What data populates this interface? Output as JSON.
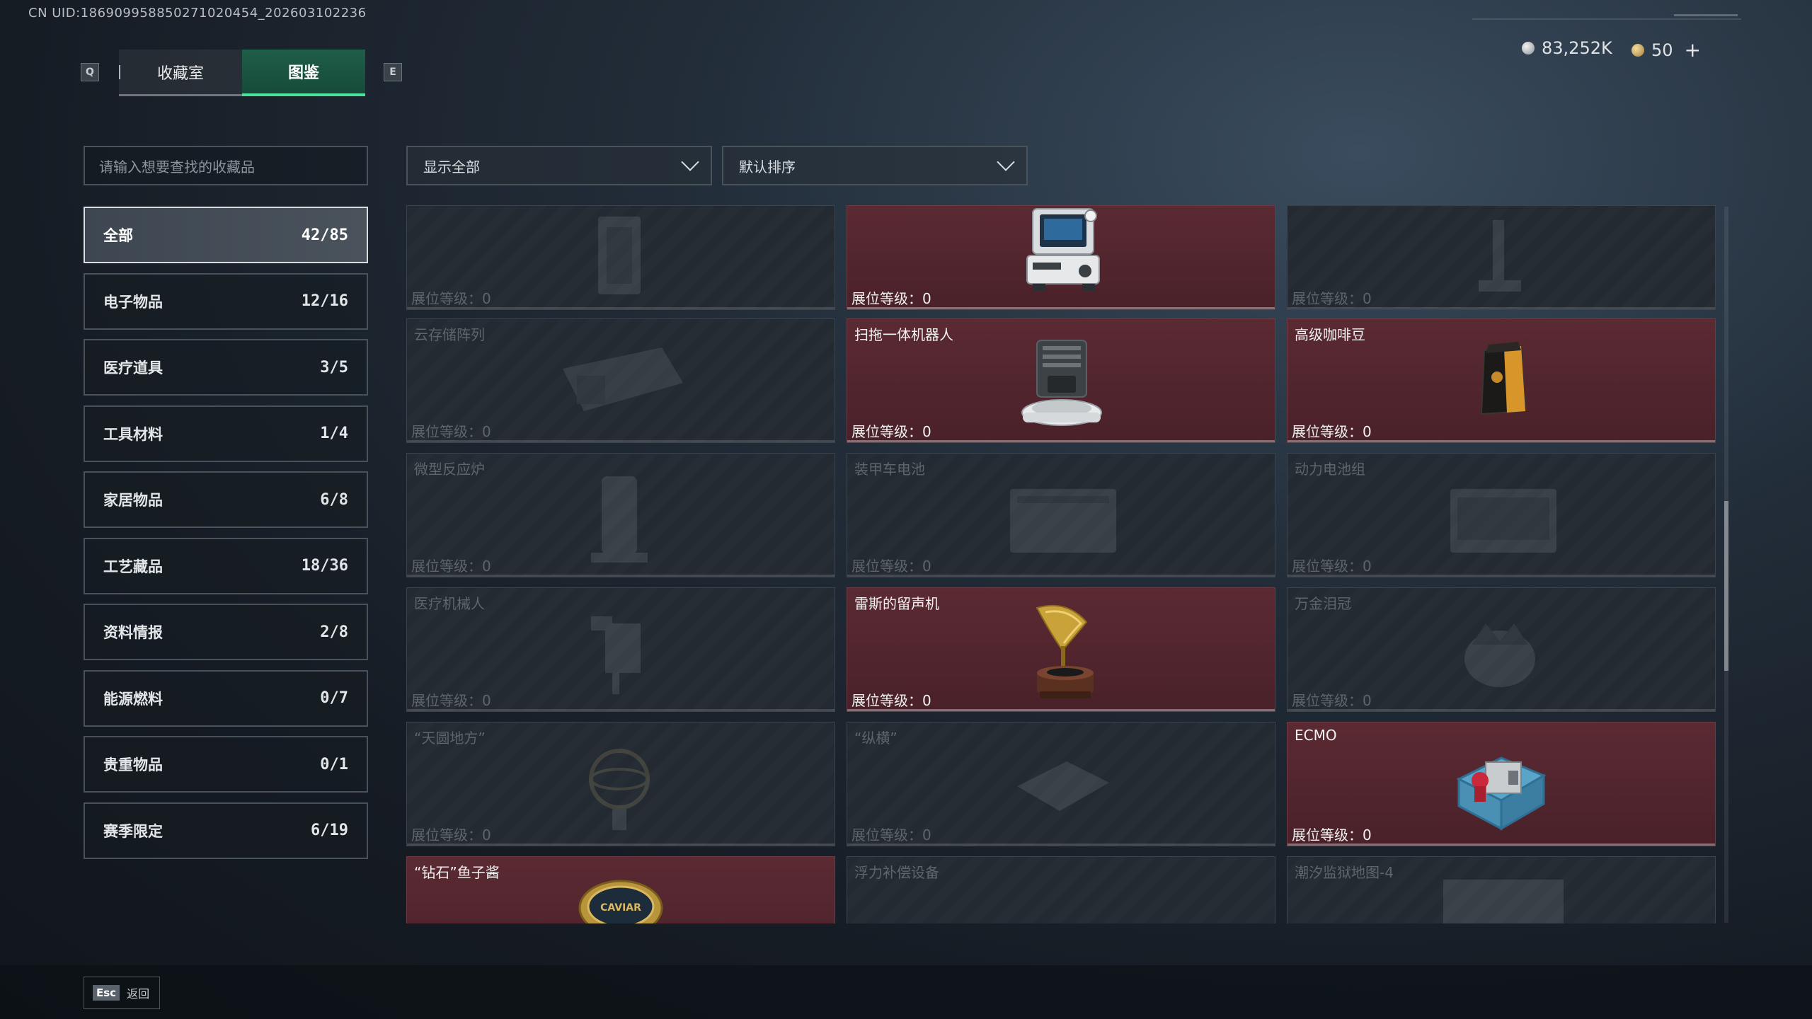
{
  "uid_text": "CN UID:1869099588502710204​54_202603102236",
  "tabs": {
    "key_left": "Q",
    "key_right": "E",
    "items": [
      "收藏室",
      "图鉴"
    ],
    "active": 1
  },
  "currency": {
    "silver": "83,252K",
    "gold": "50",
    "plus": "+"
  },
  "search": {
    "placeholder": "请输入想要查找的收藏品"
  },
  "filters": {
    "show": "显示全部",
    "sort": "默认排序"
  },
  "categories": [
    {
      "label": "全部",
      "count": "42/85",
      "active": true
    },
    {
      "label": "电子物品",
      "count": "12/16"
    },
    {
      "label": "医疗道具",
      "count": "3/5"
    },
    {
      "label": "工具材料",
      "count": "1/4"
    },
    {
      "label": "家居物品",
      "count": "6/8"
    },
    {
      "label": "工艺藏品",
      "count": "18/36"
    },
    {
      "label": "资料情报",
      "count": "2/8"
    },
    {
      "label": "能源燃料",
      "count": "0/7"
    },
    {
      "label": "贵重物品",
      "count": "0/1"
    },
    {
      "label": "赛季限定",
      "count": "6/19"
    }
  ],
  "level_label": "展位等级：0",
  "items": {
    "r0c0": {
      "name": "",
      "owned": false
    },
    "r0c1": {
      "name": "",
      "owned": true
    },
    "r0c2": {
      "name": "",
      "owned": false
    },
    "r1c0": {
      "name": "云存储阵列",
      "owned": false
    },
    "r1c1": {
      "name": "扫拖一体机器人",
      "owned": true
    },
    "r1c2": {
      "name": "高级咖啡豆",
      "owned": true
    },
    "r2c0": {
      "name": "微型反应炉",
      "owned": false
    },
    "r2c1": {
      "name": "装甲车电池",
      "owned": false
    },
    "r2c2": {
      "name": "动力电池组",
      "owned": false
    },
    "r3c0": {
      "name": "医疗机械人",
      "owned": false
    },
    "r3c1": {
      "name": "雷斯的留声机",
      "owned": true
    },
    "r3c2": {
      "name": "万金泪冠",
      "owned": false
    },
    "r4c0": {
      "name": "“天圆地方”",
      "owned": false
    },
    "r4c1": {
      "name": "“纵横”",
      "owned": false
    },
    "r4c2": {
      "name": "ECMO",
      "owned": true
    },
    "r5c0": {
      "name": "“钻石”鱼子酱",
      "owned": true
    },
    "r5c1": {
      "name": "浮力补偿设备",
      "owned": false
    },
    "r5c2": {
      "name": "潮汐监狱地图-4",
      "owned": false
    }
  },
  "caviar_label": "CAVIAR",
  "footer": {
    "key": "Esc",
    "label": "返回"
  }
}
